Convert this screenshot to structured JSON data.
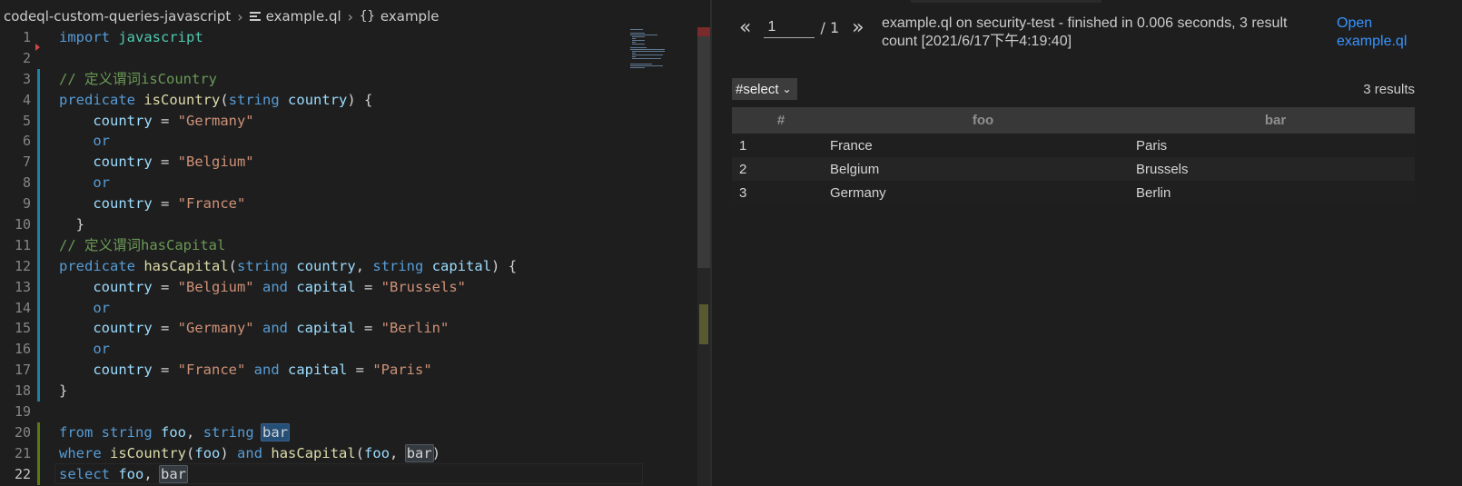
{
  "breadcrumb": {
    "folder": "codeql-custom-queries-javascript",
    "file": "example.ql",
    "symbol": "example"
  },
  "editor": {
    "current_line": 22,
    "lines": [
      {
        "n": "1",
        "tokens": [
          [
            "k",
            "import"
          ],
          [
            "p",
            " "
          ],
          [
            "t",
            "javascript"
          ]
        ]
      },
      {
        "n": "2",
        "tokens": []
      },
      {
        "n": "3",
        "tokens": [
          [
            "c",
            "// 定义谓词isCountry"
          ]
        ]
      },
      {
        "n": "4",
        "tokens": [
          [
            "k",
            "predicate"
          ],
          [
            "p",
            " "
          ],
          [
            "f",
            "isCountry"
          ],
          [
            "p",
            "("
          ],
          [
            "k",
            "string"
          ],
          [
            "p",
            " "
          ],
          [
            "v",
            "country"
          ],
          [
            "p",
            ") {"
          ]
        ]
      },
      {
        "n": "5",
        "tokens": [
          [
            "p",
            "    "
          ],
          [
            "v",
            "country"
          ],
          [
            "p",
            " = "
          ],
          [
            "s",
            "\"Germany\""
          ]
        ]
      },
      {
        "n": "6",
        "tokens": [
          [
            "p",
            "    "
          ],
          [
            "k",
            "or"
          ]
        ]
      },
      {
        "n": "7",
        "tokens": [
          [
            "p",
            "    "
          ],
          [
            "v",
            "country"
          ],
          [
            "p",
            " = "
          ],
          [
            "s",
            "\"Belgium\""
          ]
        ]
      },
      {
        "n": "8",
        "tokens": [
          [
            "p",
            "    "
          ],
          [
            "k",
            "or"
          ]
        ]
      },
      {
        "n": "9",
        "tokens": [
          [
            "p",
            "    "
          ],
          [
            "v",
            "country"
          ],
          [
            "p",
            " = "
          ],
          [
            "s",
            "\"France\""
          ]
        ]
      },
      {
        "n": "10",
        "tokens": [
          [
            "p",
            "  }"
          ]
        ]
      },
      {
        "n": "11",
        "tokens": [
          [
            "c",
            "// 定义谓词hasCapital"
          ]
        ]
      },
      {
        "n": "12",
        "tokens": [
          [
            "k",
            "predicate"
          ],
          [
            "p",
            " "
          ],
          [
            "f",
            "hasCapital"
          ],
          [
            "p",
            "("
          ],
          [
            "k",
            "string"
          ],
          [
            "p",
            " "
          ],
          [
            "v",
            "country"
          ],
          [
            "p",
            ", "
          ],
          [
            "k",
            "string"
          ],
          [
            "p",
            " "
          ],
          [
            "v",
            "capital"
          ],
          [
            "p",
            ") {"
          ]
        ]
      },
      {
        "n": "13",
        "tokens": [
          [
            "p",
            "    "
          ],
          [
            "v",
            "country"
          ],
          [
            "p",
            " = "
          ],
          [
            "s",
            "\"Belgium\""
          ],
          [
            "p",
            " "
          ],
          [
            "k",
            "and"
          ],
          [
            "p",
            " "
          ],
          [
            "v",
            "capital"
          ],
          [
            "p",
            " = "
          ],
          [
            "s",
            "\"Brussels\""
          ]
        ]
      },
      {
        "n": "14",
        "tokens": [
          [
            "p",
            "    "
          ],
          [
            "k",
            "or"
          ]
        ]
      },
      {
        "n": "15",
        "tokens": [
          [
            "p",
            "    "
          ],
          [
            "v",
            "country"
          ],
          [
            "p",
            " = "
          ],
          [
            "s",
            "\"Germany\""
          ],
          [
            "p",
            " "
          ],
          [
            "k",
            "and"
          ],
          [
            "p",
            " "
          ],
          [
            "v",
            "capital"
          ],
          [
            "p",
            " = "
          ],
          [
            "s",
            "\"Berlin\""
          ]
        ]
      },
      {
        "n": "16",
        "tokens": [
          [
            "p",
            "    "
          ],
          [
            "k",
            "or"
          ]
        ]
      },
      {
        "n": "17",
        "tokens": [
          [
            "p",
            "    "
          ],
          [
            "v",
            "country"
          ],
          [
            "p",
            " = "
          ],
          [
            "s",
            "\"France\""
          ],
          [
            "p",
            " "
          ],
          [
            "k",
            "and"
          ],
          [
            "p",
            " "
          ],
          [
            "v",
            "capital"
          ],
          [
            "p",
            " = "
          ],
          [
            "s",
            "\"Paris\""
          ]
        ]
      },
      {
        "n": "18",
        "tokens": [
          [
            "p",
            "}"
          ]
        ]
      },
      {
        "n": "19",
        "tokens": []
      },
      {
        "n": "20",
        "tokens": [
          [
            "k",
            "from"
          ],
          [
            "p",
            " "
          ],
          [
            "k",
            "string"
          ],
          [
            "p",
            " "
          ],
          [
            "v",
            "foo"
          ],
          [
            "p",
            ", "
          ],
          [
            "k",
            "string"
          ],
          [
            "p",
            " "
          ],
          [
            "hl",
            "bar"
          ]
        ]
      },
      {
        "n": "21",
        "tokens": [
          [
            "k",
            "where"
          ],
          [
            "p",
            " "
          ],
          [
            "f",
            "isCountry"
          ],
          [
            "p",
            "("
          ],
          [
            "v",
            "foo"
          ],
          [
            "p",
            ") "
          ],
          [
            "k",
            "and"
          ],
          [
            "p",
            " "
          ],
          [
            "f",
            "hasCapital"
          ],
          [
            "p",
            "("
          ],
          [
            "v",
            "foo"
          ],
          [
            "p",
            ", "
          ],
          [
            "hlw",
            "bar"
          ],
          [
            "p",
            ")"
          ]
        ]
      },
      {
        "n": "22",
        "tokens": [
          [
            "k",
            "select"
          ],
          [
            "p",
            " "
          ],
          [
            "v",
            "foo"
          ],
          [
            "p",
            ", "
          ],
          [
            "hlw",
            "bar"
          ]
        ]
      }
    ]
  },
  "pager": {
    "prev_label": "«",
    "next_label": "»",
    "page_value": "1",
    "total_label": "/ 1"
  },
  "status": {
    "text": "example.ql on security-test - finished in 0.006 seconds, 3 result count [2021/6/17下午4:19:40]",
    "open_link": "Open example.ql"
  },
  "results": {
    "select_label": "#select",
    "count_label": "3 results",
    "columns": [
      "#",
      "foo",
      "bar"
    ],
    "rows": [
      [
        "1",
        "France",
        "Paris"
      ],
      [
        "2",
        "Belgium",
        "Brussels"
      ],
      [
        "3",
        "Germany",
        "Berlin"
      ]
    ]
  },
  "colors": {
    "keyword": "#569cd6",
    "type": "#4ec9b0",
    "function": "#dcdcaa",
    "variable": "#9cdcfe",
    "string": "#ce9178",
    "comment": "#6a9955",
    "link": "#3794ff",
    "modified_bar": "#1b81a8",
    "added_bar": "#587c0c"
  }
}
